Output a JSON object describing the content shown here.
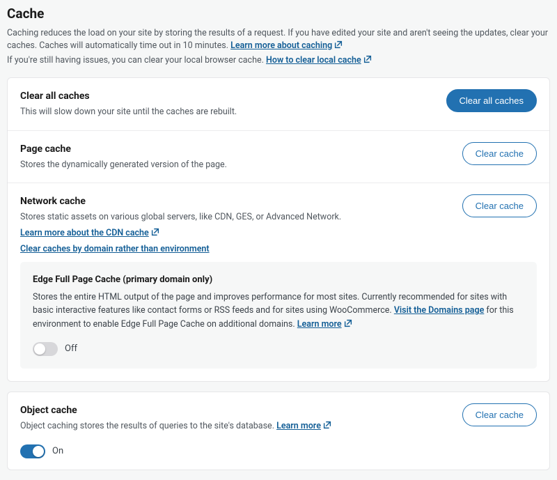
{
  "header": {
    "title": "Cache",
    "intro": "Caching reduces the load on your site by storing the results of a request. If you have edited your site and aren't seeing the updates, clear your caches. Caches will automatically time out in 10 minutes.",
    "learn_caching_link": "Learn more about caching",
    "issues_prefix": "If you're still having issues, you can clear your local browser cache.",
    "clear_local_link": "How to clear local cache"
  },
  "clear_all": {
    "title": "Clear all caches",
    "desc": "This will slow down your site until the caches are rebuilt.",
    "button": "Clear all caches"
  },
  "page_cache": {
    "title": "Page cache",
    "desc": "Stores the dynamically generated version of the page.",
    "button": "Clear cache"
  },
  "network_cache": {
    "title": "Network cache",
    "desc": "Stores static assets on various global servers, like CDN, GES, or Advanced Network.",
    "learn_cdn_link": "Learn more about the CDN cache",
    "clear_by_domain_link": "Clear caches by domain rather than environment",
    "button": "Clear cache"
  },
  "edge_cache": {
    "title": "Edge Full Page Cache (primary domain only)",
    "desc_pre": "Stores the entire HTML output of the page and improves performance for most sites. Currently recommended for sites with basic interactive features like contact forms or RSS feeds and for sites using WooCommerce.",
    "visit_domains_link": "Visit the Domains page",
    "desc_post": "for this environment to enable Edge Full Page Cache on additional domains.",
    "learn_more_link": "Learn more",
    "toggle_label": "Off",
    "toggle_state": "off"
  },
  "object_cache": {
    "title": "Object cache",
    "desc": "Object caching stores the results of queries to the site's database.",
    "learn_more_link": "Learn more",
    "button": "Clear cache",
    "toggle_label": "On",
    "toggle_state": "on"
  }
}
